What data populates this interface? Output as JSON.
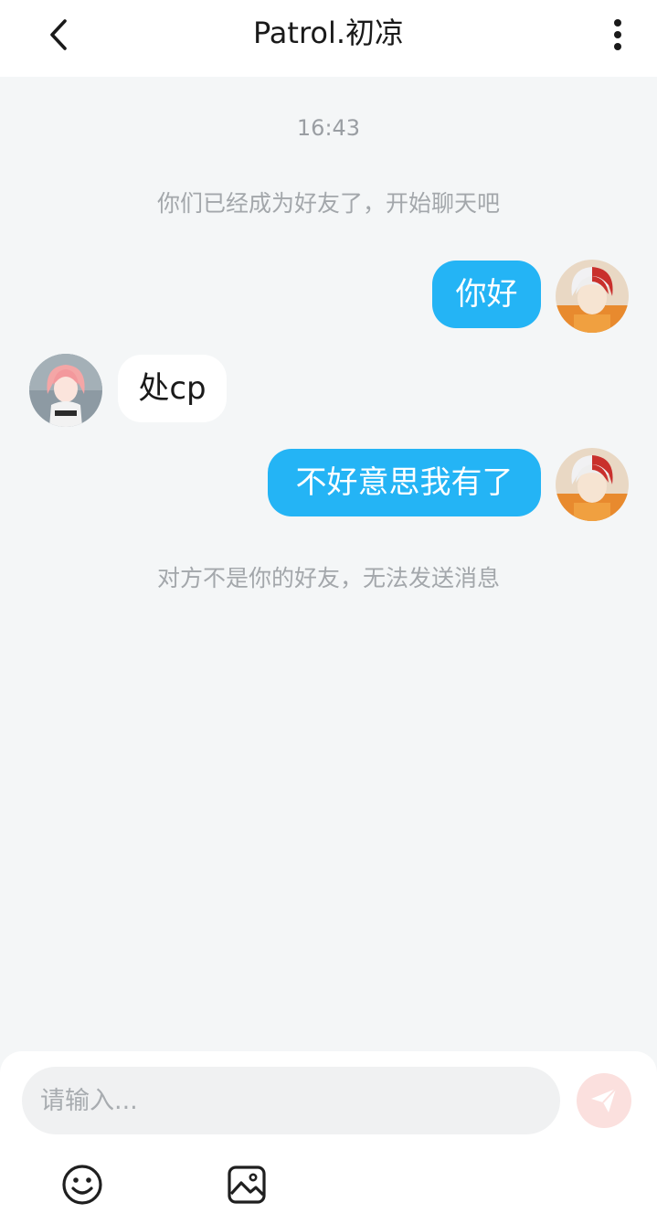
{
  "header": {
    "title": "Patrol.初凉",
    "back_icon": "chevron-left-icon",
    "more_icon": "more-vertical-icon"
  },
  "chat": {
    "timestamp": "16:43",
    "system_friend_added": "你们已经成为好友了，开始聊天吧",
    "messages": [
      {
        "direction": "out",
        "text": "你好"
      },
      {
        "direction": "in",
        "text": "处cp"
      },
      {
        "direction": "out",
        "text": "不好意思我有了"
      }
    ],
    "system_not_friend": "对方不是你的好友，无法发送消息"
  },
  "composer": {
    "placeholder": "请输入...",
    "send_icon": "send-icon",
    "emoji_icon": "emoji-icon",
    "image_icon": "image-icon"
  },
  "colors": {
    "bubble_out": "#24b4f5",
    "bubble_in": "#ffffff",
    "background": "#f4f6f7",
    "send_disabled": "#fbe0de"
  }
}
